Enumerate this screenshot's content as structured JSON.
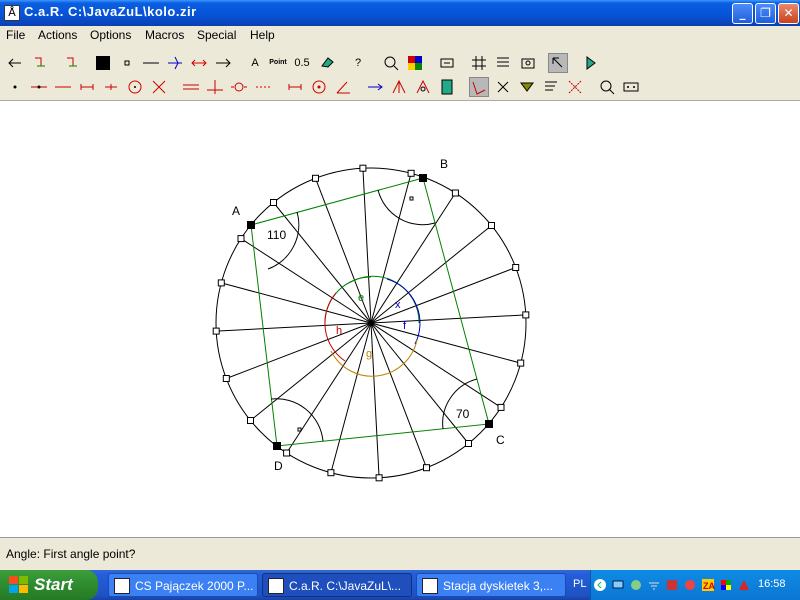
{
  "window": {
    "title": "C.a.R. C:\\JavaZuL\\kolo.zir",
    "icon": "compass-icon"
  },
  "menu": [
    "File",
    "Actions",
    "Options",
    "Macros",
    "Special",
    "Help"
  ],
  "toolbar": {
    "point_label": "Point",
    "number_label": "0.5",
    "text_label": "A",
    "help_label": "?"
  },
  "figure": {
    "point_labels": {
      "A": "A",
      "B": "B",
      "C": "C",
      "D": "D"
    },
    "angle_values": {
      "at_A": "110",
      "at_C": "70"
    },
    "center_angle_labels": {
      "e": "e",
      "x": "x",
      "f": "f",
      "g": "g",
      "h": "h"
    },
    "colors": {
      "circle": "#000000",
      "quadrilateral": "#008000",
      "arc_e": "#008000",
      "arc_x": "#0000c0",
      "arc_g": "#c08000",
      "arc_h": "#c00000"
    }
  },
  "status": "Angle: First angle point?",
  "taskbar": {
    "start": "Start",
    "tasks": [
      "CS Pajączek 2000 P...",
      "C.a.R. C:\\JavaZuL\\...",
      "Stacja dyskietek 3,..."
    ],
    "lang": "PL",
    "clock": "16:58"
  }
}
